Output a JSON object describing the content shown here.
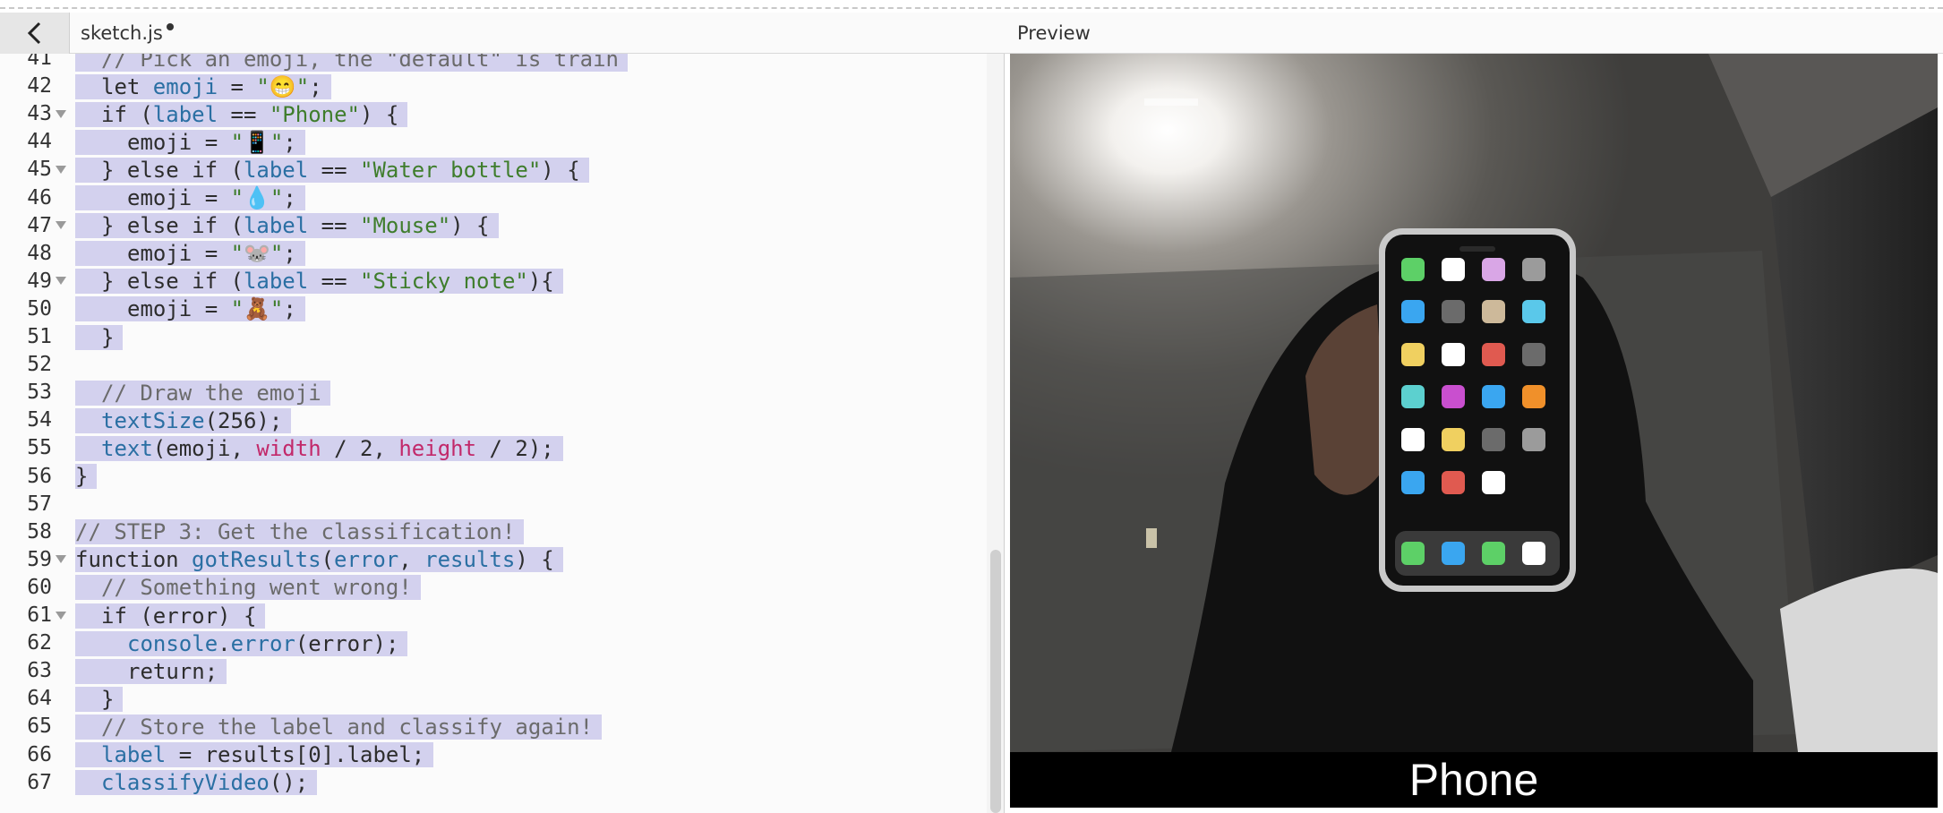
{
  "editor": {
    "file_name": "sketch.js",
    "unsaved": true,
    "lines": [
      {
        "n": "41",
        "fold": false,
        "indent": 1,
        "sel": true,
        "tokens": [
          [
            "cm",
            "// Pick an emoji, the \"default\" is train"
          ]
        ]
      },
      {
        "n": "42",
        "fold": false,
        "indent": 1,
        "sel": true,
        "tokens": [
          [
            "kw",
            "let "
          ],
          [
            "vr",
            "emoji"
          ],
          [
            "kw",
            " = "
          ],
          [
            "st",
            "\"😁\""
          ],
          [
            "kw",
            ";"
          ]
        ]
      },
      {
        "n": "43",
        "fold": true,
        "indent": 1,
        "sel": true,
        "tokens": [
          [
            "kw",
            "if ("
          ],
          [
            "vr",
            "label"
          ],
          [
            "kw",
            " == "
          ],
          [
            "st",
            "\"Phone\""
          ],
          [
            "kw",
            ") {"
          ]
        ]
      },
      {
        "n": "44",
        "fold": false,
        "indent": 2,
        "sel": true,
        "tokens": [
          [
            "kw",
            "emoji = "
          ],
          [
            "st",
            "\"📱\""
          ],
          [
            "kw",
            ";"
          ]
        ]
      },
      {
        "n": "45",
        "fold": true,
        "indent": 1,
        "sel": true,
        "tokens": [
          [
            "kw",
            "} else if ("
          ],
          [
            "vr",
            "label"
          ],
          [
            "kw",
            " == "
          ],
          [
            "st",
            "\"Water bottle\""
          ],
          [
            "kw",
            ") {"
          ]
        ]
      },
      {
        "n": "46",
        "fold": false,
        "indent": 2,
        "sel": true,
        "tokens": [
          [
            "kw",
            "emoji = "
          ],
          [
            "st",
            "\"💧\""
          ],
          [
            "kw",
            ";"
          ]
        ]
      },
      {
        "n": "47",
        "fold": true,
        "indent": 1,
        "sel": true,
        "tokens": [
          [
            "kw",
            "} else if ("
          ],
          [
            "vr",
            "label"
          ],
          [
            "kw",
            " == "
          ],
          [
            "st",
            "\"Mouse\""
          ],
          [
            "kw",
            ") {"
          ]
        ]
      },
      {
        "n": "48",
        "fold": false,
        "indent": 2,
        "sel": true,
        "tokens": [
          [
            "kw",
            "emoji = "
          ],
          [
            "st",
            "\"🐭\""
          ],
          [
            "kw",
            ";"
          ]
        ]
      },
      {
        "n": "49",
        "fold": true,
        "indent": 1,
        "sel": true,
        "tokens": [
          [
            "kw",
            "} else if ("
          ],
          [
            "vr",
            "label"
          ],
          [
            "kw",
            " == "
          ],
          [
            "st",
            "\"Sticky note\""
          ],
          [
            "kw",
            "){"
          ]
        ]
      },
      {
        "n": "50",
        "fold": false,
        "indent": 2,
        "sel": true,
        "tokens": [
          [
            "kw",
            "emoji = "
          ],
          [
            "st",
            "\"🧸\""
          ],
          [
            "kw",
            ";"
          ]
        ]
      },
      {
        "n": "51",
        "fold": false,
        "indent": 1,
        "sel": true,
        "tokens": [
          [
            "kw",
            "}"
          ]
        ]
      },
      {
        "n": "52",
        "fold": false,
        "indent": 0,
        "sel": false,
        "tokens": []
      },
      {
        "n": "53",
        "fold": false,
        "indent": 1,
        "sel": true,
        "tokens": [
          [
            "cm",
            "// Draw the emoji"
          ]
        ]
      },
      {
        "n": "54",
        "fold": false,
        "indent": 1,
        "sel": true,
        "tokens": [
          [
            "vr",
            "textSize"
          ],
          [
            "kw",
            "(256);"
          ]
        ]
      },
      {
        "n": "55",
        "fold": false,
        "indent": 1,
        "sel": true,
        "tokens": [
          [
            "vr",
            "text"
          ],
          [
            "kw",
            "(emoji, "
          ],
          [
            "gl",
            "width"
          ],
          [
            "kw",
            " / 2, "
          ],
          [
            "gl",
            "height"
          ],
          [
            "kw",
            " / 2);"
          ]
        ]
      },
      {
        "n": "56",
        "fold": false,
        "indent": 0,
        "sel": true,
        "tokens": [
          [
            "kw",
            "}"
          ]
        ]
      },
      {
        "n": "57",
        "fold": false,
        "indent": 0,
        "sel": false,
        "tokens": []
      },
      {
        "n": "58",
        "fold": false,
        "indent": 0,
        "sel": true,
        "tokens": [
          [
            "cm",
            "// STEP 3: Get the classification!"
          ]
        ]
      },
      {
        "n": "59",
        "fold": true,
        "indent": 0,
        "sel": true,
        "tokens": [
          [
            "kw",
            "function "
          ],
          [
            "vr",
            "gotResults"
          ],
          [
            "kw",
            "("
          ],
          [
            "vr",
            "error"
          ],
          [
            "kw",
            ", "
          ],
          [
            "vr",
            "results"
          ],
          [
            "kw",
            ") {"
          ]
        ]
      },
      {
        "n": "60",
        "fold": false,
        "indent": 1,
        "sel": true,
        "tokens": [
          [
            "cm",
            "// Something went wrong!"
          ]
        ]
      },
      {
        "n": "61",
        "fold": true,
        "indent": 1,
        "sel": true,
        "tokens": [
          [
            "kw",
            "if (error) {"
          ]
        ]
      },
      {
        "n": "62",
        "fold": false,
        "indent": 2,
        "sel": true,
        "tokens": [
          [
            "vr",
            "console"
          ],
          [
            "kw",
            "."
          ],
          [
            "vr",
            "error"
          ],
          [
            "kw",
            "(error);"
          ]
        ]
      },
      {
        "n": "63",
        "fold": false,
        "indent": 2,
        "sel": true,
        "tokens": [
          [
            "kw",
            "return;"
          ]
        ]
      },
      {
        "n": "64",
        "fold": false,
        "indent": 1,
        "sel": true,
        "tokens": [
          [
            "kw",
            "}"
          ]
        ]
      },
      {
        "n": "65",
        "fold": false,
        "indent": 1,
        "sel": true,
        "tokens": [
          [
            "cm",
            "// Store the label and classify again!"
          ]
        ]
      },
      {
        "n": "66",
        "fold": false,
        "indent": 1,
        "sel": true,
        "tokens": [
          [
            "vr",
            "label"
          ],
          [
            "kw",
            " = results[0].label;"
          ]
        ]
      },
      {
        "n": "67",
        "fold": false,
        "indent": 1,
        "sel": true,
        "tokens": [
          [
            "vr",
            "classifyVideo"
          ],
          [
            "kw",
            "();"
          ]
        ]
      }
    ]
  },
  "preview": {
    "title": "Preview",
    "label": "Phone",
    "app_icon_colors": [
      [
        "#5dd067",
        "#ffffff",
        "#d9a6e6",
        "#9b9b9b"
      ],
      [
        "#3aa6f0",
        "#6b6b6b",
        "#cdb99a",
        "#5ac8ea"
      ],
      [
        "#f0d060",
        "#ffffff",
        "#e05a50",
        "#6b6b6b"
      ],
      [
        "#5cd0cf",
        "#c94fcf",
        "#3aa6f0",
        "#f0902a"
      ],
      [
        "#ffffff",
        "#f0d060",
        "#6b6b6b",
        "#9b9b9b"
      ],
      [
        "#3aa6f0",
        "#e05a50",
        "#ffffff",
        null
      ]
    ],
    "dock_colors": [
      "#5dd067",
      "#3aa6f0",
      "#5dd067",
      "#ffffff"
    ]
  }
}
